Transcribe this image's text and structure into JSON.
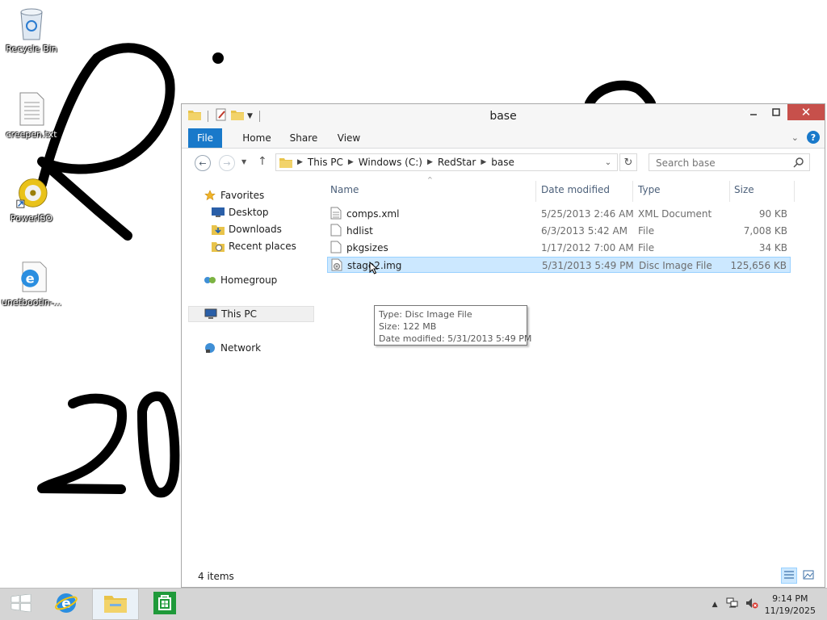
{
  "desktop": {
    "icons": [
      {
        "label": "Recycle Bin",
        "icon": "recycle-bin-icon"
      },
      {
        "label": "creepen.txt",
        "icon": "text-file-icon"
      },
      {
        "label": "PowerISO",
        "icon": "poweriso-icon"
      },
      {
        "label": "unetbootin-...",
        "icon": "internet-explorer-icon"
      }
    ],
    "doodle_color": "#000000"
  },
  "window": {
    "title": "base",
    "ribbon": {
      "tabs": [
        "File",
        "Home",
        "Share",
        "View"
      ]
    },
    "breadcrumbs": [
      "This PC",
      "Windows (C:)",
      "RedStar",
      "base"
    ],
    "search_placeholder": "Search base",
    "nav": {
      "favorites": "Favorites",
      "desktop": "Desktop",
      "downloads": "Downloads",
      "recent": "Recent places",
      "homegroup": "Homegroup",
      "this_pc": "This PC",
      "network": "Network"
    },
    "columns": {
      "name": "Name",
      "date": "Date modified",
      "type": "Type",
      "size": "Size"
    },
    "files": [
      {
        "name": "comps.xml",
        "date": "5/25/2013 2:46 AM",
        "type": "XML Document",
        "size": "90 KB"
      },
      {
        "name": "hdlist",
        "date": "6/3/2013 5:42 AM",
        "type": "File",
        "size": "7,008 KB"
      },
      {
        "name": "pkgsizes",
        "date": "1/17/2012 7:00 AM",
        "type": "File",
        "size": "34 KB"
      },
      {
        "name": "stage2.img",
        "date": "5/31/2013 5:49 PM",
        "type": "Disc Image File",
        "size": "125,656 KB"
      }
    ],
    "tooltip": {
      "type": "Type: Disc Image File",
      "size": "Size: 122 MB",
      "date": "Date modified: 5/31/2013 5:49 PM"
    },
    "status": "4 items"
  },
  "taskbar": {
    "time": "9:14 PM",
    "date": "11/19/2025",
    "accent": "#1979ca"
  }
}
